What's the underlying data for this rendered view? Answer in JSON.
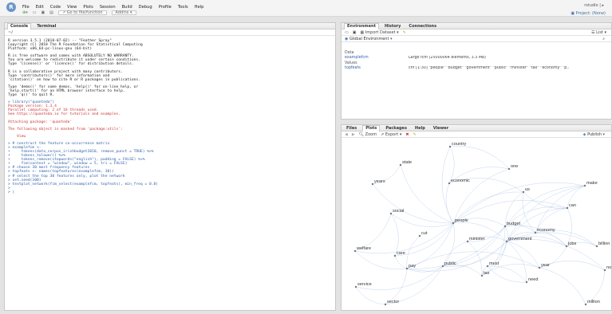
{
  "app": {
    "menu": [
      "File",
      "Edit",
      "Code",
      "View",
      "Plots",
      "Session",
      "Build",
      "Debug",
      "Profile",
      "Tools",
      "Help"
    ],
    "toolbar": {
      "go_to_file": "Go to file/function",
      "addins": "Addins"
    },
    "user": "rstudio",
    "project": "Project: (None)"
  },
  "console_pane": {
    "tabs": [
      "Console",
      "Terminal"
    ],
    "path": "~/",
    "lines": [
      {
        "t": "R version 3.5.1 (2018-07-02) -- \"Feather Spray\"",
        "c": "out"
      },
      {
        "t": "Copyright (C) 2018 The R Foundation for Statistical Computing",
        "c": "out"
      },
      {
        "t": "Platform: x86_64-pc-linux-gnu (64-bit)",
        "c": "out"
      },
      {
        "t": "",
        "c": "blank"
      },
      {
        "t": "R is free software and comes with ABSOLUTELY NO WARRANTY.",
        "c": "out"
      },
      {
        "t": "You are welcome to redistribute it under certain conditions.",
        "c": "out"
      },
      {
        "t": "Type 'license()' or 'licence()' for distribution details.",
        "c": "out"
      },
      {
        "t": "",
        "c": "blank"
      },
      {
        "t": "R is a collaborative project with many contributors.",
        "c": "out"
      },
      {
        "t": "Type 'contributors()' for more information and",
        "c": "out"
      },
      {
        "t": "'citation()' on how to cite R or R packages in publications.",
        "c": "out"
      },
      {
        "t": "",
        "c": "blank"
      },
      {
        "t": "Type 'demo()' for some demos, 'help()' for on-line help, or",
        "c": "out"
      },
      {
        "t": "'help.start()' for an HTML browser interface to help.",
        "c": "out"
      },
      {
        "t": "Type 'q()' to quit R.",
        "c": "out"
      },
      {
        "t": "",
        "c": "blank"
      },
      {
        "t": "> library(\"quanteda\")",
        "c": "prompt"
      },
      {
        "t": "Package version: 1.3.4",
        "c": "err"
      },
      {
        "t": "Parallel computing: 2 of 16 threads used.",
        "c": "err"
      },
      {
        "t": "See https://quanteda.io for tutorials and examples.",
        "c": "err"
      },
      {
        "t": "",
        "c": "blank"
      },
      {
        "t": "Attaching package: 'quanteda'",
        "c": "err"
      },
      {
        "t": "",
        "c": "blank"
      },
      {
        "t": "The following object is masked from 'package:utils':",
        "c": "err"
      },
      {
        "t": "",
        "c": "blank"
      },
      {
        "t": "    View",
        "c": "err"
      },
      {
        "t": "",
        "c": "blank"
      },
      {
        "t": "> # construct the feature co-occurrence matrix",
        "c": "prompt"
      },
      {
        "t": "> examplefcm <-",
        "c": "prompt"
      },
      {
        "t": "+     tokens(data_corpus_irishbudget2010, remove_punct = TRUE) %>%",
        "c": "prompt"
      },
      {
        "t": "+     tokens_tolower() %>%",
        "c": "prompt"
      },
      {
        "t": "+     tokens_remove(stopwords(\"english\"), padding = FALSE) %>%",
        "c": "prompt"
      },
      {
        "t": "+     fcm(context = \"window\", window = 5, tri = FALSE)",
        "c": "prompt"
      },
      {
        "t": "> # choose 30 most frequency features",
        "c": "prompt"
      },
      {
        "t": "> topfeats <- names(topfeatures(examplefcm, 30))",
        "c": "prompt"
      },
      {
        "t": "> # select the top 30 features only, plot the network",
        "c": "prompt"
      },
      {
        "t": "> set.seed(100)",
        "c": "prompt"
      },
      {
        "t": "> textplot_network(fcm_select(examplefcm, topfeats), min_freq = 0.8)",
        "c": "prompt"
      },
      {
        "t": "> ",
        "c": "prompt"
      },
      {
        "t": "> |",
        "c": "prompt"
      }
    ]
  },
  "env_pane": {
    "tabs": [
      "Environment",
      "History",
      "Connections"
    ],
    "import_label": "Import Dataset",
    "scope": "Global Environment",
    "list_label": "List",
    "data_label": "Data",
    "values_label": "Values",
    "rows": [
      {
        "name": "examplefcm",
        "value": "Large fcm (25000064 elements, 3.3 Mb)"
      },
      {
        "name": "topfeats",
        "value": "chr [1:30] \"people\" \"budget\" \"government\" \"public\" \"minister\" \"tax\" \"economy\" \"p.."
      }
    ]
  },
  "viewer_pane": {
    "tabs": [
      "Files",
      "Plots",
      "Packages",
      "Help",
      "Viewer"
    ],
    "zoom_label": "Zoom",
    "export_label": "Export",
    "publish_label": "Publish",
    "nodes": [
      "country",
      "state",
      "one",
      "years",
      "economic",
      "us",
      "make",
      "can",
      "social",
      "people",
      "budget",
      "economy",
      "cut",
      "minister",
      "government",
      "jobs",
      "billion",
      "welfare",
      "care",
      "public",
      "pay",
      "year",
      "now",
      "tax",
      "must",
      "need",
      "service",
      "sector",
      "million"
    ]
  },
  "colors": {
    "edge": "#a6c0e6",
    "prompt": "#2e5fa8",
    "message": "#c33"
  }
}
